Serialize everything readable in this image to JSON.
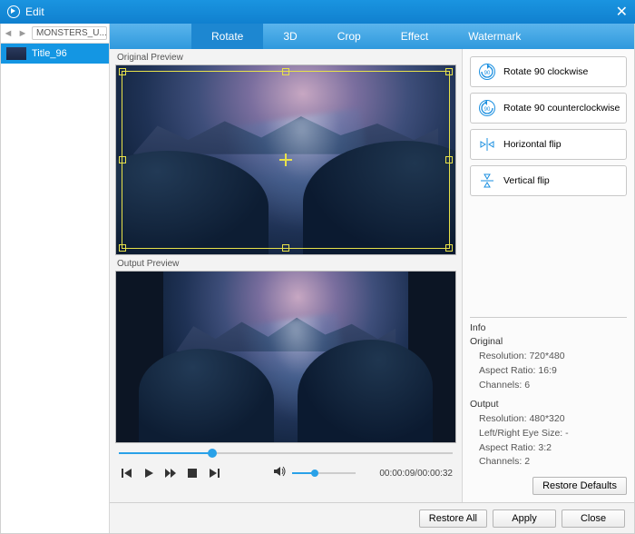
{
  "window": {
    "title": "Edit"
  },
  "sidebar": {
    "source_label": "MONSTERS_U...",
    "items": [
      {
        "label": "Title_96"
      }
    ]
  },
  "tabs": [
    {
      "label": "Rotate",
      "active": true
    },
    {
      "label": "3D"
    },
    {
      "label": "Crop"
    },
    {
      "label": "Effect"
    },
    {
      "label": "Watermark"
    }
  ],
  "preview": {
    "original_label": "Original Preview",
    "output_label": "Output Preview"
  },
  "playback": {
    "position_pct": 28,
    "volume_pct": 35,
    "time_current": "00:00:09",
    "time_total": "00:00:32"
  },
  "rotate_options": [
    {
      "id": "rotate-cw",
      "label": "Rotate 90 clockwise"
    },
    {
      "id": "rotate-ccw",
      "label": "Rotate 90 counterclockwise"
    },
    {
      "id": "flip-h",
      "label": "Horizontal flip"
    },
    {
      "id": "flip-v",
      "label": "Vertical flip"
    }
  ],
  "info": {
    "heading": "Info",
    "original": {
      "heading": "Original",
      "resolution": "Resolution: 720*480",
      "aspect": "Aspect Ratio: 16:9",
      "channels": "Channels: 6"
    },
    "output": {
      "heading": "Output",
      "resolution": "Resolution: 480*320",
      "eyesize": "Left/Right Eye Size: -",
      "aspect": "Aspect Ratio: 3:2",
      "channels": "Channels: 2"
    }
  },
  "buttons": {
    "restore_defaults": "Restore Defaults",
    "restore_all": "Restore All",
    "apply": "Apply",
    "close": "Close"
  }
}
